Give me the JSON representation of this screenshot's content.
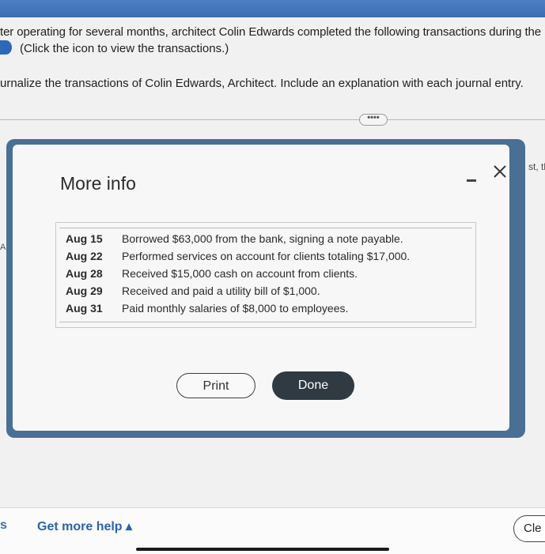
{
  "question": {
    "line1": "ter operating for several months, architect Colin Edwards completed the following transactions during the l",
    "line2": "(Click the icon to view the transactions.)",
    "line3": "urnalize the transactions of Colin Edwards, Architect. Include an explanation with each journal entry.",
    "expand_label": "••••",
    "right_cut_text": "st, th",
    "left_mark": "A"
  },
  "modal": {
    "title": "More info",
    "transactions": [
      {
        "date": "Aug 15",
        "description": "Borrowed $63,000 from the bank, signing a note payable."
      },
      {
        "date": "Aug 22",
        "description": "Performed services on account for clients totaling $17,000."
      },
      {
        "date": "Aug 28",
        "description": "Received $15,000 cash on account from clients."
      },
      {
        "date": "Aug 29",
        "description": "Received and paid a utility bill of $1,000."
      },
      {
        "date": "Aug 31",
        "description": "Paid monthly salaries of $8,000 to employees."
      }
    ],
    "print_label": "Print",
    "done_label": "Done"
  },
  "footer": {
    "left_cut": "s",
    "help_label": "Get more help ▴",
    "clear_label": "Cle"
  },
  "icons": {
    "info": "info-icon",
    "minimize": "minimize-icon",
    "close": "close-icon"
  }
}
